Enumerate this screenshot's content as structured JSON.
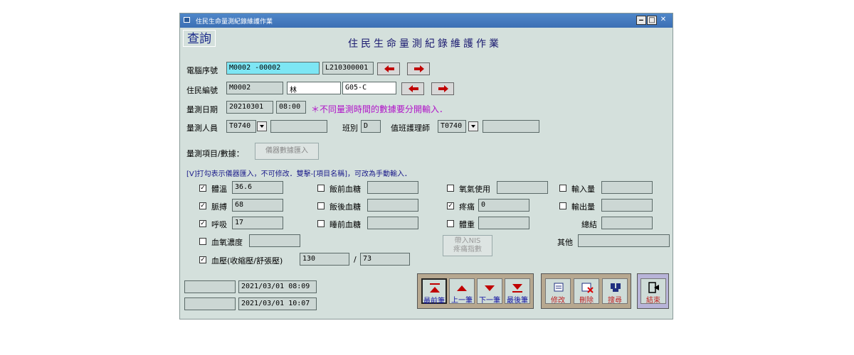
{
  "window": {
    "title": "住民生命量測紀錄維護作業"
  },
  "query_label": "查詢",
  "heading": "住民生命量測紀錄維護作業",
  "serial": {
    "label": "電腦序號",
    "value": "M0002       -00002",
    "code": "L210300001"
  },
  "resident": {
    "label": "住民編號",
    "id": "M0002",
    "name": "林",
    "bed": "G05-C"
  },
  "measure_date": {
    "label": "量測日期",
    "date": "20210301",
    "time": "08:00",
    "hint": "＊不同量測時間的數據要分開輸入．"
  },
  "staff": {
    "label": "量測人員",
    "id": "T0740",
    "name": "",
    "shift_label": "班別",
    "shift": "D",
    "nurse_label": "值班護理師",
    "nurse_id": "T0740",
    "nurse_name": ""
  },
  "items_title": "量測項目/數據：",
  "import_button": "儀器數據匯入",
  "note": "[V]打勾表示儀器匯入，不可修改．雙擊-[項目名稱]，可改為手動輸入．",
  "items": {
    "temp": {
      "label": "體溫",
      "value": "36.6",
      "checked": "☑"
    },
    "pulse": {
      "label": "脈搏",
      "value": "68"
    },
    "resp": {
      "label": "呼吸",
      "value": "17"
    },
    "spo2": {
      "label": "血氧濃度",
      "value": ""
    },
    "bp": {
      "label": "血壓(收縮壓/舒張壓)",
      "sys": "130",
      "sep": "/",
      "dia": "73"
    },
    "pre_meal": {
      "label": "飯前血糖",
      "value": ""
    },
    "post_meal": {
      "label": "飯後血糖",
      "value": ""
    },
    "bedtime": {
      "label": "睡前血糖",
      "value": ""
    },
    "oxygen": {
      "label": "氧氣使用",
      "value": ""
    },
    "pain": {
      "label": "疼痛",
      "value": "0"
    },
    "weight": {
      "label": "體重",
      "value": ""
    },
    "intake": {
      "label": "輸入量",
      "value": ""
    },
    "output": {
      "label": "輸出量",
      "value": ""
    },
    "total": {
      "label": "總結",
      "value": ""
    },
    "other": {
      "label": "其他",
      "value": ""
    }
  },
  "nis_button": "帶入NIS\n疼痛指數",
  "timestamps": {
    "created": "2021/03/01 08:09",
    "modified": "2021/03/01 10:07"
  },
  "nav": {
    "first": "最前筆",
    "prev": "上一筆",
    "next": "下一筆",
    "last": "最後筆"
  },
  "actions": {
    "edit": "修改",
    "delete": "刪除",
    "search": "搜尋",
    "exit": "結束"
  },
  "colors": {
    "title_bar": "#3c6fb4",
    "window_bg": "#d4e0dc",
    "hint": "#b012c8",
    "nav_text": "#1010a0",
    "action_text": "#c02020"
  }
}
